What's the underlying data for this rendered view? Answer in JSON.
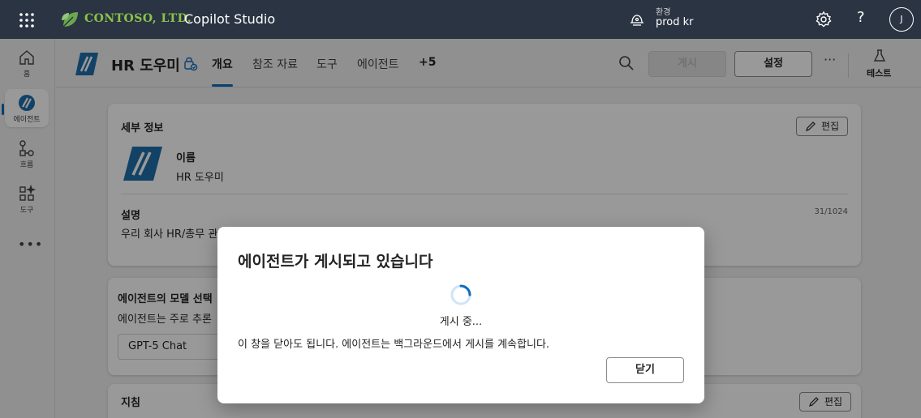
{
  "topbar": {
    "brand": "CONTOSO, LTD.",
    "app_title": "Copilot Studio",
    "env_label": "환경",
    "env_value": "prod kr",
    "help": "?",
    "avatar_initial": "J",
    "icons": [
      "waffle-icon",
      "contoso-leaf-icon",
      "environment-icon",
      "settings-gear-icon",
      "help-icon"
    ]
  },
  "rail": {
    "items": [
      {
        "label": "홈",
        "icon": "home-icon"
      },
      {
        "label": "에이전트",
        "icon": "agent-icon"
      },
      {
        "label": "흐름",
        "icon": "flow-icon"
      },
      {
        "label": "도구",
        "icon": "tools-icon"
      }
    ],
    "more": "•••"
  },
  "header": {
    "agent_name": "HR 도우미",
    "tabs": [
      "개요",
      "참조 자료",
      "도구",
      "에이전트",
      "+5"
    ],
    "active_tab": "개요",
    "publish_label": "게시",
    "settings_label": "설정",
    "more": "···",
    "test_label": "테스트"
  },
  "details_card": {
    "title": "세부 정보",
    "edit_label": "편집",
    "name_label": "이름",
    "name_value": "HR 도우미",
    "desc_label": "설명",
    "desc_value": "우리 회사 HR/총무 관",
    "desc_counter": "31/1024"
  },
  "model_card": {
    "title": "에이전트의 모델 선택",
    "subtitle": "에이전트는 주로 추론",
    "model_value": "GPT-5 Chat"
  },
  "instructions_card": {
    "title": "지침",
    "edit_label": "편집"
  },
  "dialog": {
    "title": "에이전트가 게시되고 있습니다",
    "status": "게시 중...",
    "message": "이 창을 닫아도 됩니다. 에이전트는 백그라운드에서 게시를 계속합니다.",
    "close_label": "닫기"
  },
  "colors": {
    "topbar_bg": "#2b3443",
    "accent": "#0f6cbd",
    "brand_green": "#8bc34a"
  }
}
